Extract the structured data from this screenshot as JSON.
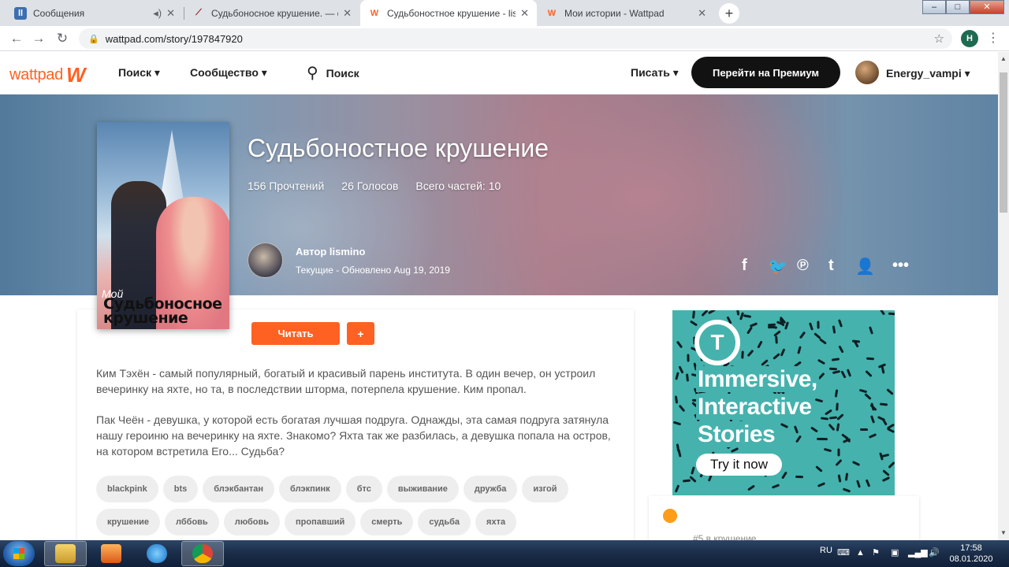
{
  "browser": {
    "tabs": [
      {
        "title": "Сообщения",
        "icon": "messages-icon",
        "audio": true
      },
      {
        "title": "Судьбоносное крушение. — фа",
        "icon": "quill-icon"
      },
      {
        "title": "Судьбоностное крушение - lismi",
        "icon": "wattpad-icon",
        "active": true
      },
      {
        "title": "Мои истории - Wattpad",
        "icon": "wattpad-icon"
      }
    ],
    "new_tab": "+",
    "url": "wattpad.com/story/197847920",
    "profile_initial": "Н",
    "window_controls": {
      "minimize": "–",
      "maximize": "□",
      "close": "✕"
    }
  },
  "header": {
    "logo_text": "wattpad",
    "logo_mark": "W",
    "nav": {
      "search": "Поиск",
      "community": "Сообщество"
    },
    "search_label": "Поиск",
    "write": "Писать",
    "premium": "Перейти на Премиум",
    "username": "Energy_vampi"
  },
  "story": {
    "title": "Судьбоностное крушение",
    "stats": {
      "reads": "156 Прочтений",
      "votes": "26 Голосов",
      "parts": "Всего частей: 10"
    },
    "author": "Автор lismino",
    "status": "Текущие - Обновлено Aug 19, 2019",
    "cover_title": "Судьбоносное крушение",
    "cover_script": "Мой",
    "read_button": "Читать",
    "add_button": "+",
    "description": [
      "Ким Тэхён - самый популярный, богатый и красивый парень института. В один вечер, он устроил вечеринку на яхте, но та, в последствии шторма, потерпела крушение. Ким пропал.",
      "Пак Чеён - девушка, у которой есть богатая лучшая подруга. Однажды, эта самая подруга затянула нашу героиню на вечеринку на яхте. Знакомо? Яхта так же разбилась, а девушка попала на остров, на котором встретила Его... Судьба?"
    ],
    "tags": [
      "blackpink",
      "bts",
      "блэкбантан",
      "блэкпинк",
      "бтс",
      "выживание",
      "дружба",
      "изгой",
      "крушение",
      "лббовь",
      "любовь",
      "пропавший",
      "смерть",
      "судьба",
      "яхта"
    ],
    "share_icons": [
      "facebook-icon",
      "twitter-icon",
      "pinterest-icon",
      "tumblr-icon",
      "user-icon",
      "more-icon"
    ]
  },
  "ad": {
    "headline": [
      "Immersive,",
      "Interactive",
      "Stories"
    ],
    "cta": "Try it now",
    "logo_letter": "T"
  },
  "sidecard": {
    "text": "#5 в крушение"
  },
  "taskbar": {
    "language": "RU",
    "time": "17:58",
    "date": "08.01.2020"
  },
  "colors": {
    "brand": "#ff6122",
    "premium_bg": "#121212",
    "ad_bg": "#45b2ad",
    "tab_strip": "#dee1e6"
  }
}
